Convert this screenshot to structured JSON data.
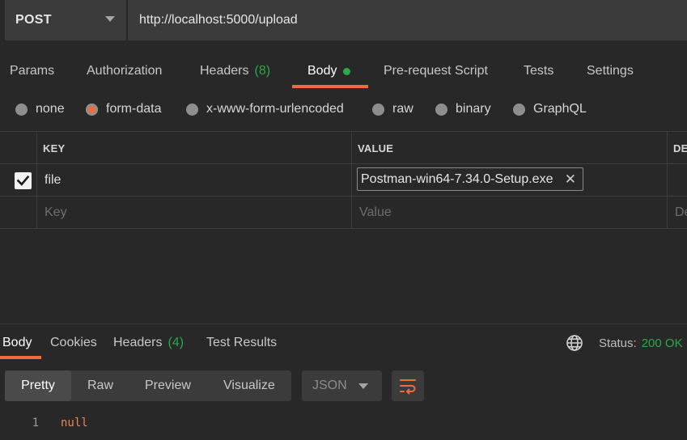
{
  "request": {
    "method": "POST",
    "url": "http://localhost:5000/upload"
  },
  "request_tabs": [
    {
      "label": "Params"
    },
    {
      "label": "Authorization"
    },
    {
      "label": "Headers",
      "count": "(8)"
    },
    {
      "label": "Body",
      "active": true,
      "indicator_color": "#2aa84a"
    },
    {
      "label": "Pre-request Script"
    },
    {
      "label": "Tests"
    },
    {
      "label": "Settings"
    }
  ],
  "body_types": [
    {
      "label": "none"
    },
    {
      "label": "form-data",
      "selected": true
    },
    {
      "label": "x-www-form-urlencoded"
    },
    {
      "label": "raw"
    },
    {
      "label": "binary"
    },
    {
      "label": "GraphQL"
    }
  ],
  "form_table": {
    "headers": {
      "key": "KEY",
      "value": "VALUE",
      "description": "DE"
    },
    "rows": [
      {
        "checked": true,
        "key": "file",
        "value": "Postman-win64-7.34.0-Setup.exe",
        "value_type": "file"
      }
    ],
    "new_row": {
      "key_placeholder": "Key",
      "value_placeholder": "Value",
      "description_placeholder": "De"
    }
  },
  "response": {
    "tabs": [
      {
        "label": "Body",
        "active": true
      },
      {
        "label": "Cookies"
      },
      {
        "label": "Headers",
        "count": "(4)"
      },
      {
        "label": "Test Results"
      }
    ],
    "status_label": "Status:",
    "status_code": "200 OK",
    "view_modes": [
      {
        "label": "Pretty",
        "active": true
      },
      {
        "label": "Raw"
      },
      {
        "label": "Preview"
      },
      {
        "label": "Visualize"
      }
    ],
    "format": "JSON",
    "lines": [
      {
        "number": "1",
        "text": "null"
      }
    ]
  },
  "colors": {
    "accent": "#f26b3a",
    "success": "#2aa84a",
    "background": "#282828",
    "panel": "#3b3b3b"
  },
  "icons": [
    "chevron-down-icon",
    "checkmark-icon",
    "close-icon",
    "globe-icon",
    "wrap-lines-icon"
  ]
}
